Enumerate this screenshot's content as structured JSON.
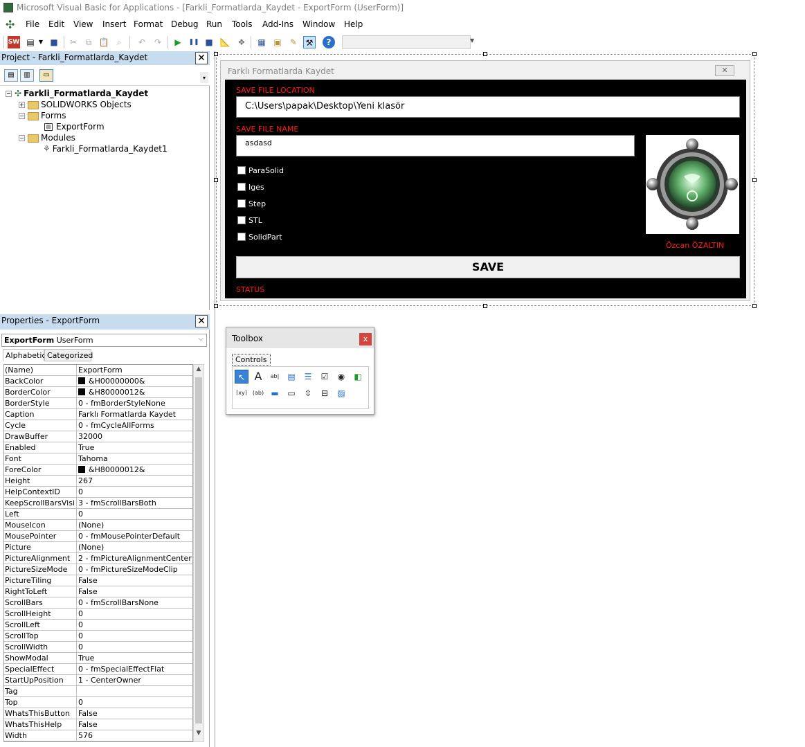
{
  "window": {
    "title": "Microsoft Visual Basic for Applications - [Farkli_Formatlarda_Kaydet - ExportForm (UserForm)]"
  },
  "menu": {
    "items": [
      "File",
      "Edit",
      "View",
      "Insert",
      "Format",
      "Debug",
      "Run",
      "Tools",
      "Add-Ins",
      "Window",
      "Help"
    ]
  },
  "project": {
    "header": "Project - Farkli_Formatlarda_Kaydet",
    "close": "✕",
    "tree": {
      "root": "Farkli_Formatlarda_Kaydet",
      "solidworks": "SOLIDWORKS Objects",
      "forms": "Forms",
      "form_item": "ExportForm",
      "modules": "Modules",
      "module_item": "Farkli_Formatlarda_Kaydet1"
    }
  },
  "properties": {
    "header": "Properties - ExportForm",
    "close": "✕",
    "object_name": "ExportForm",
    "object_type": "UserForm",
    "tabs": [
      "Alphabetic",
      "Categorized"
    ],
    "rows": [
      {
        "name": "(Name)",
        "value": "ExportForm"
      },
      {
        "name": "BackColor",
        "value": "&H00000000&",
        "swatch": "#000000"
      },
      {
        "name": "BorderColor",
        "value": "&H80000012&",
        "swatch": "#000000"
      },
      {
        "name": "BorderStyle",
        "value": "0 - fmBorderStyleNone"
      },
      {
        "name": "Caption",
        "value": "Farklı Formatlarda Kaydet"
      },
      {
        "name": "Cycle",
        "value": "0 - fmCycleAllForms"
      },
      {
        "name": "DrawBuffer",
        "value": "32000"
      },
      {
        "name": "Enabled",
        "value": "True"
      },
      {
        "name": "Font",
        "value": "Tahoma"
      },
      {
        "name": "ForeColor",
        "value": "&H80000012&",
        "swatch": "#000000"
      },
      {
        "name": "Height",
        "value": "267"
      },
      {
        "name": "HelpContextID",
        "value": "0"
      },
      {
        "name": "KeepScrollBarsVisible",
        "value": "3 - fmScrollBarsBoth"
      },
      {
        "name": "Left",
        "value": "0"
      },
      {
        "name": "MouseIcon",
        "value": "(None)"
      },
      {
        "name": "MousePointer",
        "value": "0 - fmMousePointerDefault"
      },
      {
        "name": "Picture",
        "value": "(None)"
      },
      {
        "name": "PictureAlignment",
        "value": "2 - fmPictureAlignmentCenter"
      },
      {
        "name": "PictureSizeMode",
        "value": "0 - fmPictureSizeModeClip"
      },
      {
        "name": "PictureTiling",
        "value": "False"
      },
      {
        "name": "RightToLeft",
        "value": "False"
      },
      {
        "name": "ScrollBars",
        "value": "0 - fmScrollBarsNone"
      },
      {
        "name": "ScrollHeight",
        "value": "0"
      },
      {
        "name": "ScrollLeft",
        "value": "0"
      },
      {
        "name": "ScrollTop",
        "value": "0"
      },
      {
        "name": "ScrollWidth",
        "value": "0"
      },
      {
        "name": "ShowModal",
        "value": "True"
      },
      {
        "name": "SpecialEffect",
        "value": "0 - fmSpecialEffectFlat"
      },
      {
        "name": "StartUpPosition",
        "value": "1 - CenterOwner"
      },
      {
        "name": "Tag",
        "value": ""
      },
      {
        "name": "Top",
        "value": "0"
      },
      {
        "name": "WhatsThisButton",
        "value": "False"
      },
      {
        "name": "WhatsThisHelp",
        "value": "False"
      },
      {
        "name": "Width",
        "value": "576"
      }
    ]
  },
  "userform": {
    "caption": "Farklı Formatlarda Kaydet",
    "close": "✕",
    "save_location_label": "SAVE FILE LOCATION",
    "save_location_value": "C:\\Users\\papak\\Desktop\\Yeni klasör",
    "save_name_label": "SAVE FILE NAME",
    "save_name_value": "asdasd",
    "checkboxes": [
      "ParaSolid",
      "Iges",
      "Step",
      "STL",
      "SolidPart"
    ],
    "author": "Özcan ÖZALTIN",
    "save_button": "SAVE",
    "status_label": "STATUS"
  },
  "toolbox": {
    "title": "Toolbox",
    "close": "x",
    "tab": "Controls"
  },
  "colors": {
    "accent_red": "#ff1a1a",
    "form_bg": "#000000",
    "pane_header": "#c8dcef"
  }
}
